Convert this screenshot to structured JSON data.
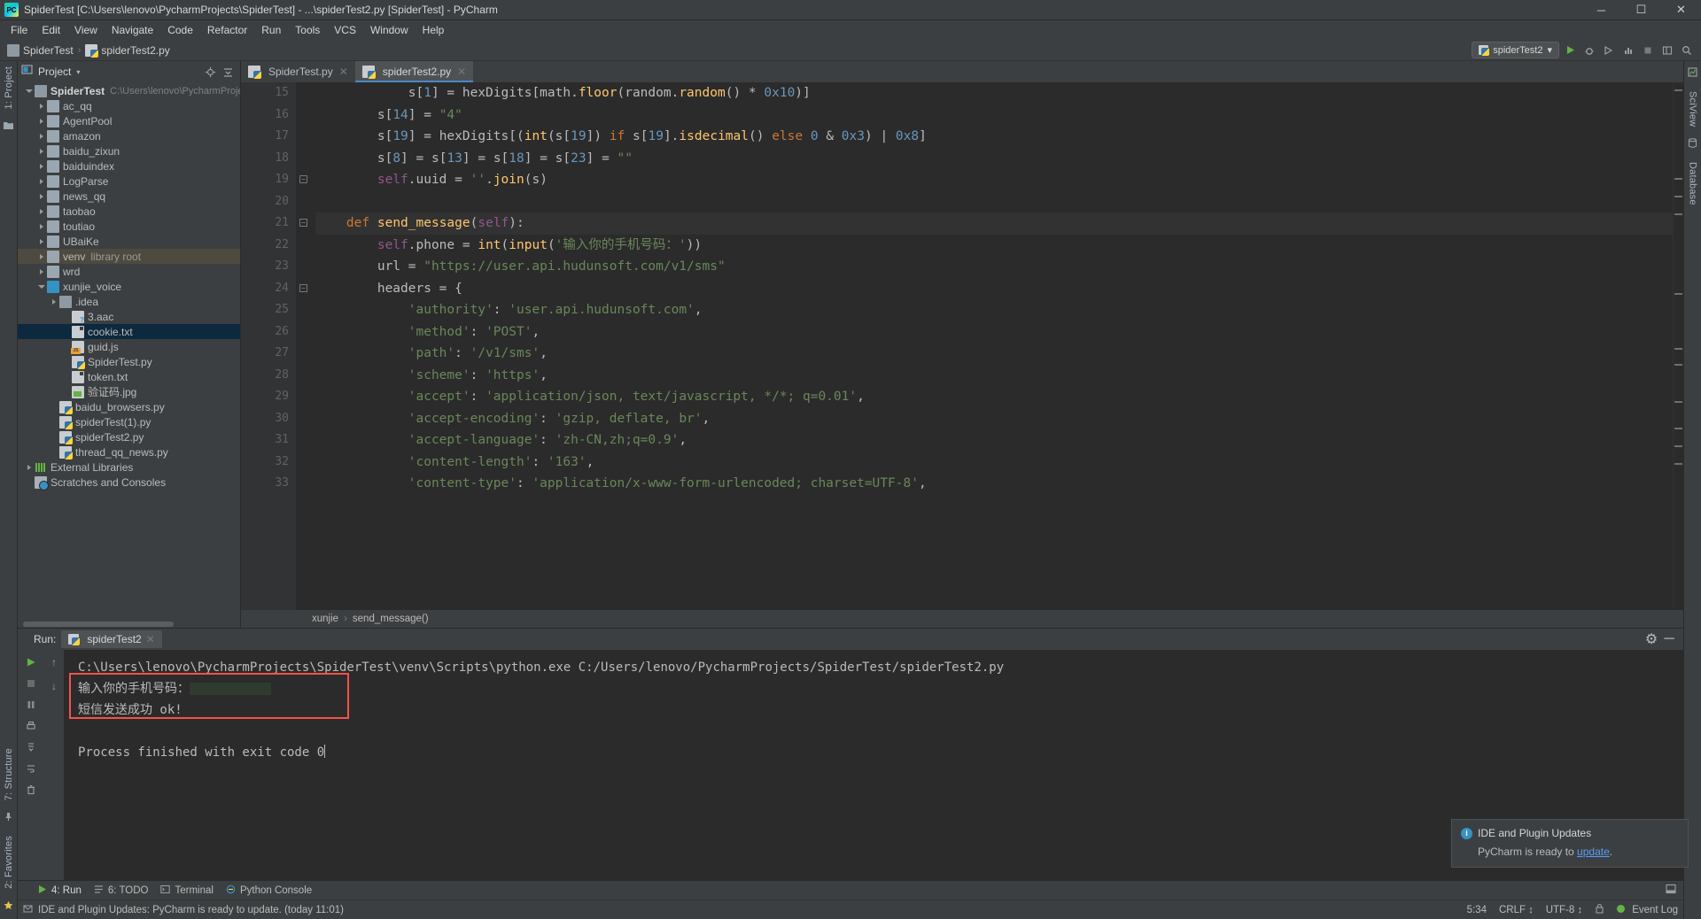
{
  "window": {
    "title": "SpiderTest [C:\\Users\\lenovo\\PycharmProjects\\SpiderTest] - ...\\spiderTest2.py [SpiderTest] - PyCharm",
    "minimize": "─",
    "maximize": "☐",
    "close": "✕"
  },
  "menu": [
    "File",
    "Edit",
    "View",
    "Navigate",
    "Code",
    "Refactor",
    "Run",
    "Tools",
    "VCS",
    "Window",
    "Help"
  ],
  "navbar": {
    "crumbs": [
      "SpiderTest",
      "spiderTest2.py"
    ],
    "separator": "›",
    "run_config": "spiderTest2",
    "run_config_caret": "▾",
    "icons": [
      "run-icon",
      "debug-icon",
      "coverage-icon",
      "profile-icon",
      "stop-icon",
      "layout-icon",
      "search-icon"
    ]
  },
  "project_panel": {
    "title": "Project",
    "caret": "▾",
    "locate_icon": "⊕",
    "collapse_icon": "≡",
    "tree": [
      {
        "depth": 0,
        "arrow": "open",
        "icon": "folder-dark",
        "label": "SpiderTest",
        "sub": "C:\\Users\\lenovo\\PycharmProjects\\S",
        "bold": true,
        "state": ""
      },
      {
        "depth": 1,
        "arrow": "closed",
        "icon": "folder",
        "label": "ac_qq",
        "sub": "",
        "bold": false,
        "state": ""
      },
      {
        "depth": 1,
        "arrow": "closed",
        "icon": "folder",
        "label": "AgentPool",
        "sub": "",
        "bold": false,
        "state": ""
      },
      {
        "depth": 1,
        "arrow": "closed",
        "icon": "folder",
        "label": "amazon",
        "sub": "",
        "bold": false,
        "state": ""
      },
      {
        "depth": 1,
        "arrow": "closed",
        "icon": "folder",
        "label": "baidu_zixun",
        "sub": "",
        "bold": false,
        "state": ""
      },
      {
        "depth": 1,
        "arrow": "closed",
        "icon": "folder",
        "label": "baiduindex",
        "sub": "",
        "bold": false,
        "state": ""
      },
      {
        "depth": 1,
        "arrow": "closed",
        "icon": "folder",
        "label": "LogParse",
        "sub": "",
        "bold": false,
        "state": ""
      },
      {
        "depth": 1,
        "arrow": "closed",
        "icon": "folder",
        "label": "news_qq",
        "sub": "",
        "bold": false,
        "state": ""
      },
      {
        "depth": 1,
        "arrow": "closed",
        "icon": "folder",
        "label": "taobao",
        "sub": "",
        "bold": false,
        "state": ""
      },
      {
        "depth": 1,
        "arrow": "closed",
        "icon": "folder",
        "label": "toutiao",
        "sub": "",
        "bold": false,
        "state": ""
      },
      {
        "depth": 1,
        "arrow": "closed",
        "icon": "folder",
        "label": "UBaiKe",
        "sub": "",
        "bold": false,
        "state": ""
      },
      {
        "depth": 1,
        "arrow": "closed",
        "icon": "folder",
        "label": "venv",
        "sub2": "library root",
        "sub": "",
        "bold": false,
        "state": "sel-dim"
      },
      {
        "depth": 1,
        "arrow": "closed",
        "icon": "folder",
        "label": "wrd",
        "sub": "",
        "bold": false,
        "state": ""
      },
      {
        "depth": 1,
        "arrow": "open",
        "icon": "folder-blue",
        "label": "xunjie_voice",
        "sub": "",
        "bold": false,
        "state": ""
      },
      {
        "depth": 2,
        "arrow": "closed",
        "icon": "folder-dark",
        "label": ".idea",
        "sub": "",
        "bold": false,
        "state": ""
      },
      {
        "depth": 3,
        "arrow": "none",
        "icon": "aac",
        "label": "3.aac",
        "sub": "",
        "bold": false,
        "state": ""
      },
      {
        "depth": 3,
        "arrow": "none",
        "icon": "file",
        "label": "cookie.txt",
        "sub": "",
        "bold": false,
        "state": "sel"
      },
      {
        "depth": 3,
        "arrow": "none",
        "icon": "js",
        "label": "guid.js",
        "sub": "",
        "bold": false,
        "state": ""
      },
      {
        "depth": 3,
        "arrow": "none",
        "icon": "py",
        "label": "SpiderTest.py",
        "sub": "",
        "bold": false,
        "state": ""
      },
      {
        "depth": 3,
        "arrow": "none",
        "icon": "file",
        "label": "token.txt",
        "sub": "",
        "bold": false,
        "state": ""
      },
      {
        "depth": 3,
        "arrow": "none",
        "icon": "img",
        "label": "验证码.jpg",
        "sub": "",
        "bold": false,
        "state": ""
      },
      {
        "depth": 2,
        "arrow": "none",
        "icon": "py",
        "label": "baidu_browsers.py",
        "sub": "",
        "bold": false,
        "state": ""
      },
      {
        "depth": 2,
        "arrow": "none",
        "icon": "py",
        "label": "spiderTest(1).py",
        "sub": "",
        "bold": false,
        "state": ""
      },
      {
        "depth": 2,
        "arrow": "none",
        "icon": "py",
        "label": "spiderTest2.py",
        "sub": "",
        "bold": false,
        "state": ""
      },
      {
        "depth": 2,
        "arrow": "none",
        "icon": "py",
        "label": "thread_qq_news.py",
        "sub": "",
        "bold": false,
        "state": ""
      },
      {
        "depth": 0,
        "arrow": "closed",
        "icon": "lib",
        "label": "External Libraries",
        "sub": "",
        "bold": false,
        "state": ""
      },
      {
        "depth": 0,
        "arrow": "none",
        "icon": "scratch",
        "label": "Scratches and Consoles",
        "sub": "",
        "bold": false,
        "state": ""
      }
    ]
  },
  "rails": {
    "left_top": "1: Project",
    "left_bottom_1": "2: Favorites",
    "left_bottom_2": "7: Structure",
    "right_top_1": "SciView",
    "right_top_2": "Database"
  },
  "editor": {
    "tabs": [
      {
        "label": "SpiderTest.py",
        "active": false,
        "close": "✕"
      },
      {
        "label": "spiderTest2.py",
        "active": true,
        "close": "✕"
      }
    ],
    "first_line_number": 15,
    "lines": [
      {
        "num": 15,
        "fold": "",
        "cur": false,
        "html": "            s[1] = hexDigits[math.floor(random.random() * 0x10)]"
      },
      {
        "num": 16,
        "fold": "",
        "cur": false,
        "html": "        s[14] = \"4\""
      },
      {
        "num": 17,
        "fold": "",
        "cur": false,
        "html": "        s[19] = hexDigits[(int(s[19]) if s[19].isdecimal() else 0 & 0x3) | 0x8]"
      },
      {
        "num": 18,
        "fold": "",
        "cur": false,
        "html": "        s[8] = s[13] = s[18] = s[23] = \"\""
      },
      {
        "num": 19,
        "fold": "end",
        "cur": false,
        "html": "        self.uuid = ''.join(s)"
      },
      {
        "num": 20,
        "fold": "",
        "cur": false,
        "html": ""
      },
      {
        "num": 21,
        "fold": "start",
        "cur": true,
        "html": "    def send_message(self):"
      },
      {
        "num": 22,
        "fold": "",
        "cur": false,
        "html": "        self.phone = int(input('输入你的手机号码：'))"
      },
      {
        "num": 23,
        "fold": "",
        "cur": false,
        "html": "        url = \"https://user.api.hudunsoft.com/v1/sms\""
      },
      {
        "num": 24,
        "fold": "start",
        "cur": false,
        "html": "        headers = {"
      },
      {
        "num": 25,
        "fold": "",
        "cur": false,
        "html": "            'authority': 'user.api.hudunsoft.com',"
      },
      {
        "num": 26,
        "fold": "",
        "cur": false,
        "html": "            'method': 'POST',"
      },
      {
        "num": 27,
        "fold": "",
        "cur": false,
        "html": "            'path': '/v1/sms',"
      },
      {
        "num": 28,
        "fold": "",
        "cur": false,
        "html": "            'scheme': 'https',"
      },
      {
        "num": 29,
        "fold": "",
        "cur": false,
        "html": "            'accept': 'application/json, text/javascript, */*; q=0.01',"
      },
      {
        "num": 30,
        "fold": "",
        "cur": false,
        "html": "            'accept-encoding': 'gzip, deflate, br',"
      },
      {
        "num": 31,
        "fold": "",
        "cur": false,
        "html": "            'accept-language': 'zh-CN,zh;q=0.9',"
      },
      {
        "num": 32,
        "fold": "",
        "cur": false,
        "html": "            'content-length': '163',"
      },
      {
        "num": 33,
        "fold": "",
        "cur": false,
        "html": "            'content-type': 'application/x-www-form-urlencoded; charset=UTF-8',"
      }
    ],
    "breadcrumbs": [
      "xunjie",
      "send_message()"
    ],
    "breadcrumb_sep": "›"
  },
  "run_panel": {
    "label": "Run:",
    "tab_label": "spiderTest2",
    "tab_close": "✕",
    "settings_icon": "⚙",
    "minimize_icon": "─",
    "console_lines": [
      {
        "text": "C:\\Users\\lenovo\\PycharmProjects\\SpiderTest\\venv\\Scripts\\python.exe C:/Users/lenovo/PycharmProjects/SpiderTest/spiderTest2.py",
        "kind": "cmd"
      },
      {
        "text": "输入你的手机号码：",
        "kind": "redacted"
      },
      {
        "text": "短信发送成功 ok!",
        "kind": "plain"
      },
      {
        "text": "",
        "kind": "plain"
      },
      {
        "text": "Process finished with exit code 0",
        "kind": "caret"
      }
    ],
    "highlight_color": "#f4524a"
  },
  "notification": {
    "title": "IDE and Plugin Updates",
    "body_prefix": "PyCharm is ready to ",
    "link": "update",
    "body_suffix": ".",
    "info_glyph": "i"
  },
  "tool_tabs": [
    {
      "label": "4: Run",
      "icon": "run-icon",
      "active": true
    },
    {
      "label": "6: TODO",
      "icon": "todo-icon",
      "active": false
    },
    {
      "label": "Terminal",
      "icon": "terminal-icon",
      "active": false
    },
    {
      "label": "Python Console",
      "icon": "python-console-icon",
      "active": false
    }
  ],
  "statusbar": {
    "message": "IDE and Plugin Updates: PyCharm is ready to update. (today 11:01)",
    "position": "5:34",
    "line_sep": "CRLF",
    "encoding": "UTF-8",
    "event_log": "Event Log",
    "lock_glyph": "🔒",
    "caret_sep": "↕"
  }
}
